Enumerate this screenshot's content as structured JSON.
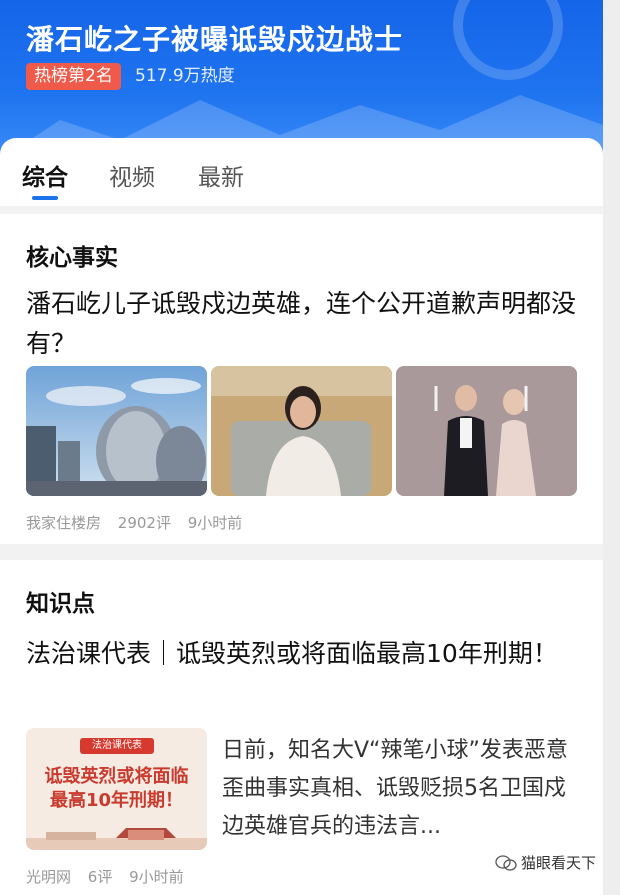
{
  "header": {
    "title": "潘石屹之子被曝诋毁戍边战士",
    "rank_badge": "热榜第2名",
    "heat": "517.9万热度"
  },
  "tabs": [
    {
      "label": "综合",
      "active": true
    },
    {
      "label": "视频",
      "active": false
    },
    {
      "label": "最新",
      "active": false
    }
  ],
  "core_facts": {
    "section_title": "核心事实",
    "headline": "潘石屹儿子诋毁戍边英雄，连个公开道歉声明都没有？",
    "source": "我家住楼房",
    "comments": "2902评",
    "time": "9小时前"
  },
  "knowledge": {
    "section_title": "知识点",
    "headline": "法治课代表｜诋毁英烈或将面临最高10年刑期！",
    "poster_tag": "法治课代表",
    "poster_line1": "诋毁英烈或将面临",
    "poster_line2": "最高10年刑期！",
    "summary": "日前，知名大V“辣笔小球”发表恶意歪曲事实真相、诋毁贬损5名卫国戍边英雄官兵的违法言...",
    "source": "光明网",
    "comments": "6评",
    "time": "9小时前"
  },
  "watermark": "猫眼看天下",
  "colors": {
    "brand_blue": "#1a73e8",
    "badge_red": "#f05a4a"
  }
}
